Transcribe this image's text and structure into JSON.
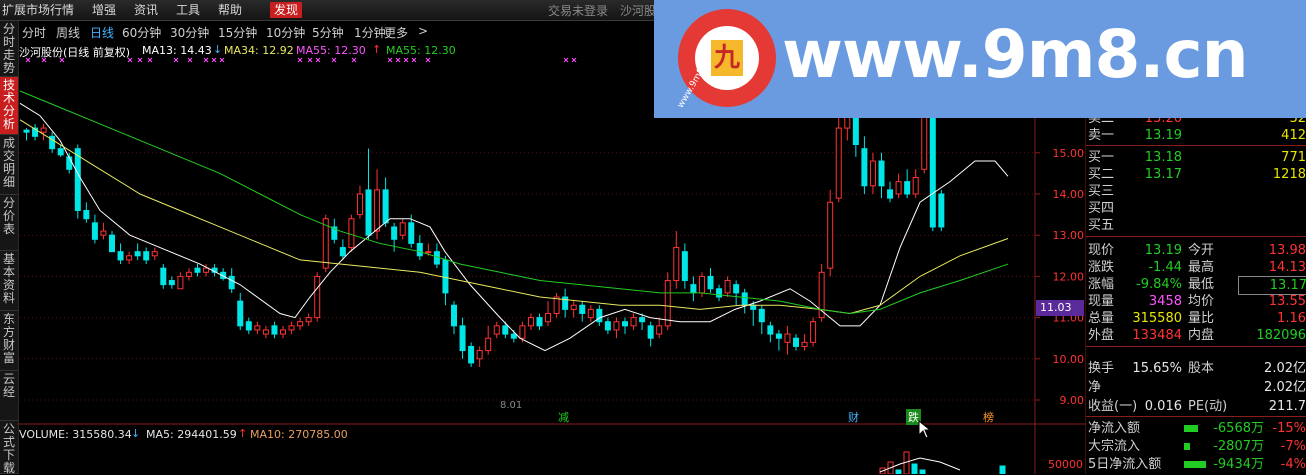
{
  "menubar": {
    "items": [
      "扩展市场行情",
      "增强",
      "资讯",
      "工具",
      "帮助",
      "发现"
    ],
    "right_texts": [
      "交易未登录",
      "沙河股"
    ]
  },
  "period_tabs": [
    "分时",
    "周线",
    "日线",
    "60分钟",
    "30分钟",
    "15分钟",
    "10分钟",
    "5分钟",
    "1分钟",
    "更多",
    ">"
  ],
  "side_tabs": [
    "分时走势",
    "技术分析",
    "成交明细",
    "分价表",
    "基本资料",
    "东方财富",
    "云经",
    "公式下载"
  ],
  "indicator_line": {
    "title": "沙河股份(日线 前复权)",
    "ma13": "MA13: 14.43",
    "ma34": "MA34: 12.92",
    "ma55a": "MA55: 12.30",
    "ma55b": "MA55: 12.30"
  },
  "price_axis": [
    "15.00",
    "14.00",
    "13.00",
    "12.00",
    "11.00",
    "10.00",
    "9.00"
  ],
  "current_price_tag": "11.03",
  "event_markers": [
    "减",
    "财",
    "跌",
    "榜"
  ],
  "volume_line": {
    "volume": "VOLUME: 315580.34",
    "ma5": "MA5: 294401.59",
    "ma10": "MA10: 270785.00"
  },
  "volume_axis": [
    "50000"
  ],
  "bottom_left_number": "8.01",
  "quote": {
    "sell1": {
      "label": "卖一",
      "price": "13.19",
      "vol": "412"
    },
    "sell_cut": {
      "label": "卖二",
      "price": "13.20",
      "vol": "32"
    },
    "buy": [
      {
        "label": "买一",
        "price": "13.18",
        "vol": "771"
      },
      {
        "label": "买二",
        "price": "13.17",
        "vol": "1218"
      },
      {
        "label": "买三",
        "price": "",
        "vol": ""
      },
      {
        "label": "买四",
        "price": "",
        "vol": ""
      },
      {
        "label": "买五",
        "price": "",
        "vol": ""
      }
    ],
    "stats": [
      {
        "l1": "现价",
        "v1": "13.19",
        "l2": "今开",
        "v2": "13.98"
      },
      {
        "l1": "涨跌",
        "v1": "-1.44",
        "l2": "最高",
        "v2": "14.13"
      },
      {
        "l1": "涨幅",
        "v1": "-9.84%",
        "l2": "最低",
        "v2": "13.17"
      },
      {
        "l1": "现量",
        "v1": "3458",
        "l2": "均价",
        "v2": "13.55"
      },
      {
        "l1": "总量",
        "v1": "315580",
        "l2": "量比",
        "v2": "1.16"
      },
      {
        "l1": "外盘",
        "v1": "133484",
        "l2": "内盘",
        "v2": "182096"
      }
    ],
    "stats2": [
      {
        "l1": "换手",
        "v1": "15.65%",
        "l2": "股本",
        "v2": "2.02亿"
      },
      {
        "l1": "净",
        "v1": "",
        "l2": "",
        "v2": "2.02亿"
      },
      {
        "l1": "收益(一)",
        "v1": "0.016",
        "l2": "PE(动)",
        "v2": "211.7"
      }
    ],
    "flows": [
      {
        "label": "净流入额",
        "value": "-6568万",
        "pct": "-15%"
      },
      {
        "label": "大宗流入",
        "value": "-2807万",
        "pct": "-7%"
      },
      {
        "label": "5日净流入额",
        "value": "-9434万",
        "pct": "-4%"
      }
    ]
  },
  "watermark": {
    "text": "www.9m8.cn",
    "logo_char": "九",
    "logo_ring": "www.9m8.cn"
  }
}
